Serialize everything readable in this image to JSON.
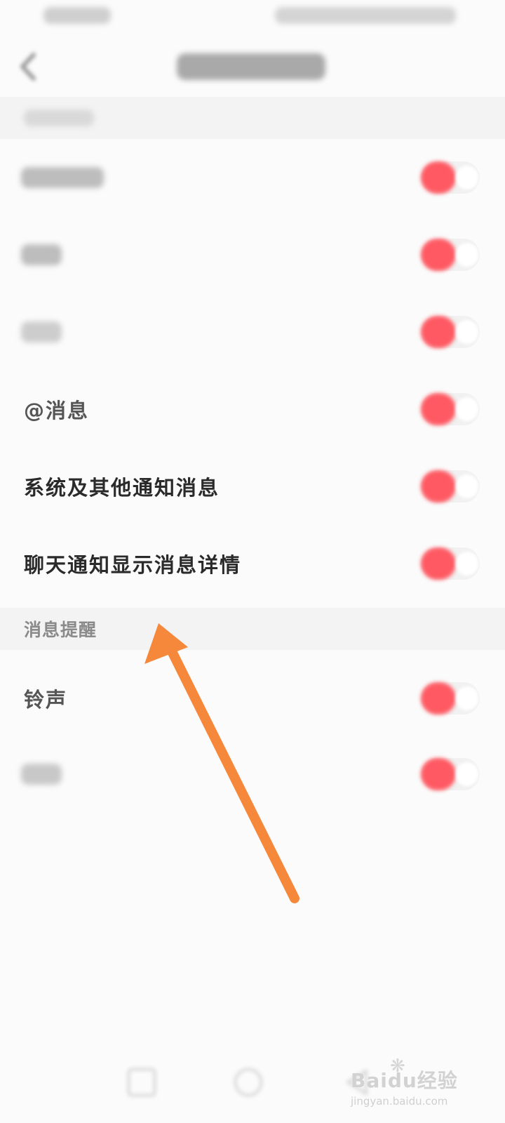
{
  "section_message_reminder": {
    "title": "消息提醒"
  },
  "rows": [
    {
      "label": "@消息",
      "enabled": true
    },
    {
      "label": "系统及其他通知消息",
      "enabled": true
    },
    {
      "label": "聊天通知显示消息详情",
      "enabled": true
    },
    {
      "label": "铃声",
      "enabled": true
    }
  ],
  "colors": {
    "toggle_on": "#ff5a63",
    "arrow": "#f5883a",
    "background": "#fbfbfb"
  },
  "icons": {
    "back": "back-chevron-icon",
    "arrow": "annotation-arrow"
  },
  "watermark": {
    "logo": "Baidu经验",
    "url": "jingyan.baidu.com"
  }
}
